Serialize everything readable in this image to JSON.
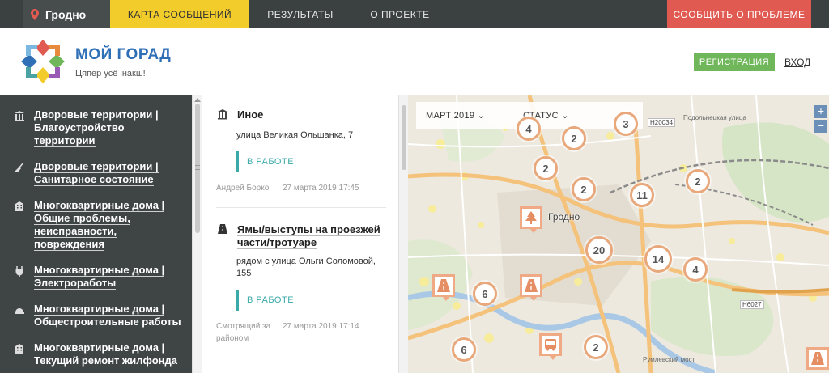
{
  "topbar": {
    "city": "Гродно",
    "tabs": [
      {
        "label": "КАРТА СООБЩЕНИЙ",
        "active": true
      },
      {
        "label": "РЕЗУЛЬТАТЫ",
        "active": false
      },
      {
        "label": "О ПРОЕКТЕ",
        "active": false
      }
    ],
    "report_label": "СООБЩИТЬ О ПРОБЛЕМЕ"
  },
  "header": {
    "brand": "МОЙ ГОРАД",
    "tagline": "Цяпер усё інакш!",
    "register_label": "РЕГИСТРАЦИЯ",
    "login_label": "ВХОД"
  },
  "sidebar": {
    "items": [
      {
        "icon": "columns-icon",
        "lines": [
          "Дворовые территории |",
          "Благоустройство",
          "территории"
        ]
      },
      {
        "icon": "broom-icon",
        "lines": [
          "Дворовые территории |",
          "Санитарное состояние"
        ]
      },
      {
        "icon": "building-icon",
        "lines": [
          "Многоквартирные дома |",
          "Общие проблемы,",
          "неисправности,",
          "повреждения"
        ]
      },
      {
        "icon": "plug-icon",
        "lines": [
          "Многоквартирные дома |",
          "Электроработы"
        ]
      },
      {
        "icon": "helmet-icon",
        "lines": [
          "Многоквартирные дома |",
          "Общестроительные работы"
        ]
      },
      {
        "icon": "building-icon",
        "lines": [
          "Многоквартирные дома |",
          "Текущий ремонт жилфонда"
        ]
      }
    ]
  },
  "feed": {
    "posts": [
      {
        "icon": "columns-icon",
        "title_lines": [
          "Иное"
        ],
        "address_lines": [
          "улица Великая Ольшанка, 7"
        ],
        "status": "В РАБОТЕ",
        "author_lines": [
          "Андрей Борко"
        ],
        "date": "27 марта 2019 17:45"
      },
      {
        "icon": "road-icon",
        "title_lines": [
          "Ямы/выступы на проезжей",
          "части/тротуаре"
        ],
        "address_lines": [
          "рядом с улица Ольги Соломовой,",
          "155"
        ],
        "status": "В РАБОТЕ",
        "author_lines": [
          "Смотрящий за",
          "районом"
        ],
        "date": "27 марта 2019 17:14"
      }
    ]
  },
  "map": {
    "filters": {
      "month": "МАРТ 2019",
      "status": "СТАТУС"
    },
    "zoom_in": "+",
    "zoom_out": "−",
    "city_label": "Гродно",
    "road_tags": [
      "H20034",
      "H6027"
    ],
    "street_labels": [
      "Подольнецкая улица",
      "Румлевский мост"
    ],
    "clusters": [
      "4",
      "3",
      "2",
      "2",
      "2",
      "11",
      "2",
      "20",
      "14",
      "4",
      "6",
      "6",
      "2"
    ],
    "markers": [
      "tree-marker-icon",
      "road-marker-icon",
      "road-marker-icon",
      "bus-marker-icon",
      "road-marker-icon"
    ]
  },
  "colors": {
    "topbar": "#3b4040",
    "active_tab": "#f2cc2a",
    "report": "#e05a52",
    "register": "#6fb75a",
    "status": "#3aa9a8",
    "sidebar": "#3f4444",
    "brand": "#2e6fb6"
  }
}
